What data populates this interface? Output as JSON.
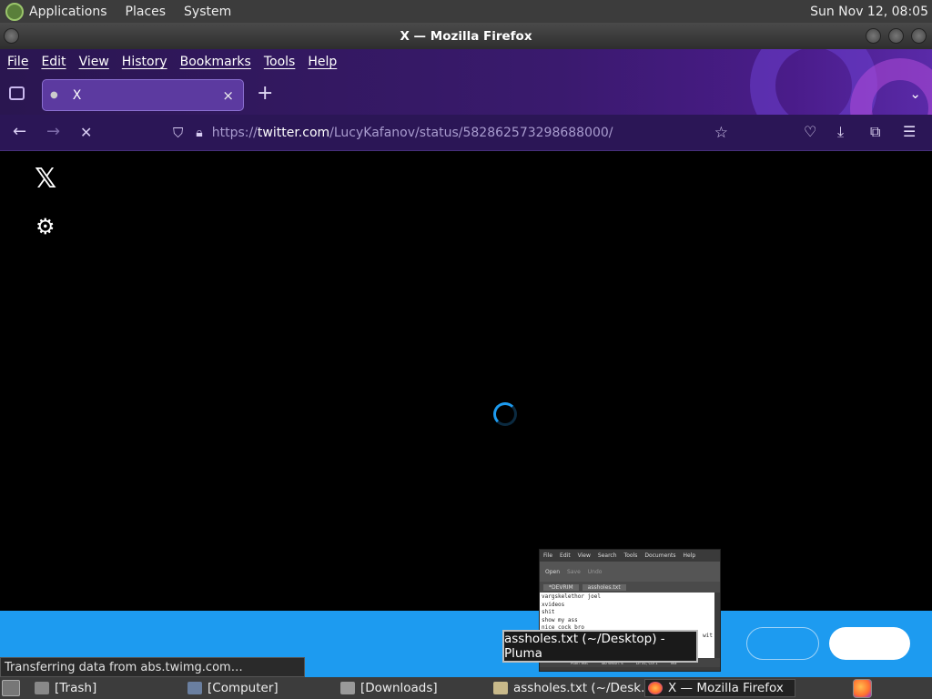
{
  "top_panel": {
    "menus": [
      "Applications",
      "Places",
      "System"
    ],
    "clock": "Sun Nov 12, 08:05"
  },
  "window": {
    "title": "X — Mozilla Firefox"
  },
  "firefox": {
    "menubar": [
      "File",
      "Edit",
      "View",
      "History",
      "Bookmarks",
      "Tools",
      "Help"
    ],
    "tab": {
      "title": "X",
      "close": "×"
    },
    "new_tab": "+",
    "tabs_dropdown": "⌄",
    "nav": {
      "back": "←",
      "forward": "→",
      "stop": "✕"
    },
    "url": {
      "prefix": "https://",
      "domain": "twitter.com",
      "path": "/LucyKafanov/status/582862573298688000/"
    },
    "status_text": "Transferring data from abs.twimg.com…"
  },
  "page": {
    "logo": "𝕏",
    "settings_icon": "gear-icon",
    "accent_color": "#1d9bf0"
  },
  "preview": {
    "menus": [
      "File",
      "Edit",
      "View",
      "Search",
      "Tools",
      "Documents",
      "Help"
    ],
    "toolbar": [
      "Open",
      "Save",
      "Undo"
    ],
    "tabs": [
      "*DEVRIM",
      "assholes.txt"
    ],
    "lines": [
      "vargskelethor joel",
      "xvideos",
      "shit",
      "show my ass",
      "nice cock bro"
    ],
    "status": [
      "Plain Text",
      "Tab Width: 4",
      "Ln 31, Col 1",
      "INS"
    ],
    "peek_text": "wit"
  },
  "tooltip": "assholes.txt (~/Desktop) - Pluma",
  "taskbar": {
    "items": [
      "[Trash]",
      "[Computer]",
      "[Downloads]",
      "assholes.txt (~/Desk...",
      "X — Mozilla Firefox"
    ]
  }
}
